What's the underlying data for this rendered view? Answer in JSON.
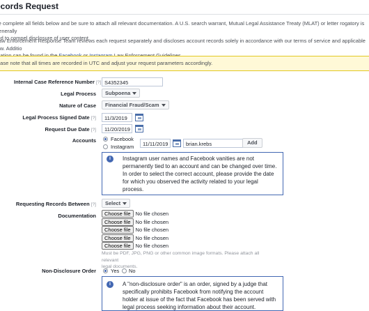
{
  "page": {
    "title": "ecords Request",
    "intro1_line1": "se complete all fields below and be sure to attach all relevant documentation. A U.S. search warrant, Mutual Legal Assistance Treaty (MLAT) or letter rogatory is generally",
    "intro1_line2": "red to compel disclosure of user content.",
    "intro2_line1": "Law Enforcement Response Team reviews each request separately and discloses account records solely in accordance with our terms of service and applicable law. Additio",
    "intro2_line2_pre": "mation can be found in the ",
    "intro2_link_facebook": "Facebook",
    "intro2_or": " or ",
    "intro2_link_instagram": "Instagram",
    "intro2_line2_post": " Law Enforcement Guidelines.",
    "notice": "ease note that all times are recorded in UTC and adjust your request parameters accordingly."
  },
  "form": {
    "help_mark": "[?]",
    "case_ref_label": "Internal Case Reference Number",
    "case_ref_value": "S4352345",
    "legal_process_label": "Legal Process",
    "legal_process_value": "Subpoena",
    "nature_label": "Nature of Case",
    "nature_value": "Financial Fraud/Scam",
    "signed_date_label": "Legal Process Signed Date",
    "signed_date_value": "11/3/2019",
    "due_date_label": "Request Due Date",
    "due_date_value": "11/20/2019",
    "accounts_label": "Accounts",
    "account_opt_facebook": "Facebook",
    "account_opt_instagram": "Instagram",
    "account_date_value": "11/11/2019",
    "account_name_value": "brian.krebs",
    "add_button": "Add",
    "accounts_info": [
      "Instagram user names and Facebook vanities are not",
      "permanently tied to an account and can be changed over time.",
      "In order to select the correct account, please provide the date",
      "for which you observed the activity related to your legal",
      "process."
    ],
    "requesting_label": "Requesting Records Between",
    "requesting_value": "Select",
    "documentation_label": "Documentation",
    "choose_file": "Choose file",
    "no_file": "No file chosen",
    "file_count": 5,
    "doc_hint_line1": "Must be PDF, JPG, PNG or other common image formats. Please attach all relevant",
    "doc_hint_line2": "legal documents.",
    "nondisclosure_label": "Non-Disclosure Order",
    "nd_yes": "Yes",
    "nd_no": "No",
    "nd_info": [
      "A \"non-disclosure order\" is an order, signed by a judge that",
      "specifically prohibits Facebook from notifying the account",
      "holder at issue of the fact that Facebook has been served with",
      "legal process seeking information about their account."
    ]
  },
  "colors": {
    "accent": "#4267b2",
    "notice_bg": "#fff9d7",
    "link": "#385898"
  }
}
